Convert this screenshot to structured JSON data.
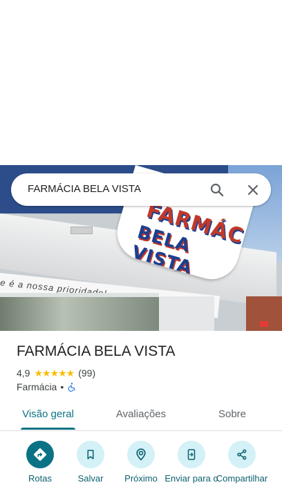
{
  "search": {
    "query": "FARMÁCIA BELA VISTA",
    "search_icon": "search-icon",
    "close_icon": "close-icon"
  },
  "photo": {
    "sign_line1": "FARMÁCIA",
    "sign_line2": "BELA VISTA",
    "banner_text": "e é a nossa prioridade!"
  },
  "place": {
    "name": "FARMÁCIA BELA VISTA",
    "rating": "4,9",
    "stars": "★★★★★",
    "reviews_count": "(99)",
    "category": "Farmácia",
    "separator": "•",
    "accessibility_icon": "wheelchair-icon",
    "colors": {
      "stars": "#fbbc04",
      "accent": "#0b7285"
    }
  },
  "tabs": [
    {
      "label": "Visão geral",
      "active": true
    },
    {
      "label": "Avaliações",
      "active": false
    },
    {
      "label": "Sobre",
      "active": false
    }
  ],
  "actions": [
    {
      "label": "Rotas",
      "icon": "directions-icon"
    },
    {
      "label": "Salvar",
      "icon": "bookmark-icon"
    },
    {
      "label": "Próximo",
      "icon": "nearby-icon"
    },
    {
      "label": "Enviar para o",
      "icon": "send-to-phone-icon"
    },
    {
      "label": "Compartilhar",
      "icon": "share-icon"
    }
  ]
}
